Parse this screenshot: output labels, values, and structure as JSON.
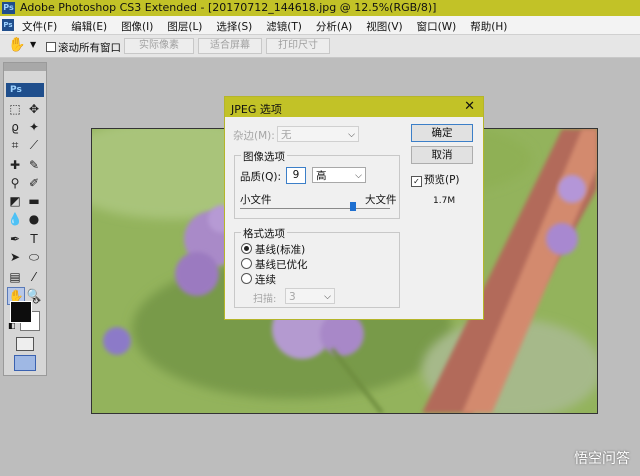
{
  "titlebar": {
    "title": "Adobe Photoshop CS3 Extended - [20170712_144618.jpg @ 12.5%(RGB/8)]"
  },
  "menu": [
    "文件(F)",
    "编辑(E)",
    "图像(I)",
    "图层(L)",
    "选择(S)",
    "滤镜(T)",
    "分析(A)",
    "视图(V)",
    "窗口(W)",
    "帮助(H)"
  ],
  "options": {
    "scroll_all_label": "滚动所有窗口",
    "actual_pixels": "实际像素",
    "fit_screen": "适合屏幕",
    "print_size": "打印尺寸"
  },
  "toolbox": {
    "logo": "Ps"
  },
  "dialog": {
    "title": "JPEG 选项",
    "matte_label": "杂边(M):",
    "matte_value": "无",
    "ok": "确定",
    "cancel": "取消",
    "preview_label": "预览(P)",
    "preview_checked": true,
    "file_size": "1.7M",
    "image_options_legend": "图像选项",
    "quality_label": "品质(Q):",
    "quality_value": "9",
    "quality_preset": "高",
    "small_file": "小文件",
    "large_file": "大文件",
    "slider_fraction": 0.75,
    "format_legend": "格式选项",
    "formats": [
      {
        "label": "基线(标准)",
        "selected": true
      },
      {
        "label": "基线已优化",
        "selected": false
      },
      {
        "label": "连续",
        "selected": false
      }
    ],
    "scans_label": "扫描:",
    "scans_value": "3"
  },
  "watermark": "悟空问答"
}
